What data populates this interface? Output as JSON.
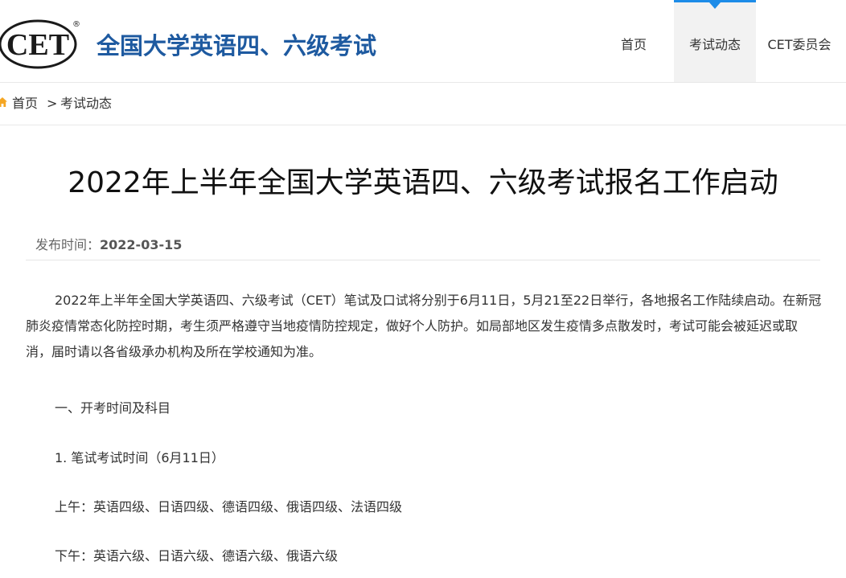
{
  "header": {
    "logo_text": "CET",
    "logo_mark": "®",
    "site_title": "全国大学英语四、六级考试",
    "nav": [
      {
        "label": "首页"
      },
      {
        "label": "考试动态"
      },
      {
        "label": "CET委员会"
      }
    ]
  },
  "breadcrumb": {
    "home": "首页",
    "separator": ">",
    "current": "考试动态"
  },
  "article": {
    "title": "2022年上半年全国大学英语四、六级考试报名工作启动",
    "meta_label": "发布时间：",
    "date": "2022-03-15",
    "intro": "2022年上半年全国大学英语四、六级考试（CET）笔试及口试将分别于6月11日，5月21至22日举行，各地报名工作陆续启动。在新冠肺炎疫情常态化防控时期，考生须严格遵守当地疫情防控规定，做好个人防护。如局部地区发生疫情多点散发时，考试可能会被延迟或取消，届时请以各省级承办机构及所在学校通知为准。",
    "section_heading": "一、开考时间及科目",
    "sub_heading": "1. 笔试考试时间（6月11日）",
    "morning": "上午：英语四级、日语四级、德语四级、俄语四级、法语四级",
    "afternoon": "下午：英语六级、日语六级、德语六级、俄语六级"
  },
  "colors": {
    "brand_blue": "#1e5aa0",
    "nav_accent": "#1d8ce8",
    "home_icon": "#f5a623"
  }
}
